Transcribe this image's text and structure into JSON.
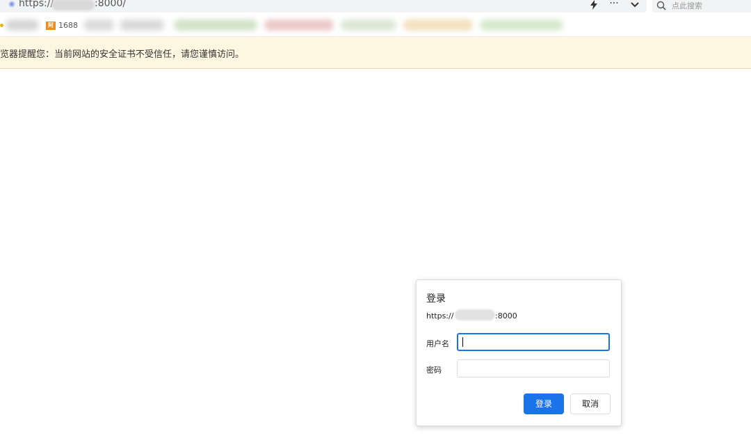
{
  "address_bar": {
    "url_prefix": "https://",
    "url_suffix": ":8000/",
    "lightning_icon": "lightning-icon",
    "more_label": "···",
    "chevron_icon": "chevron-down-icon",
    "search_placeholder": "点此搜索"
  },
  "bookmarks": {
    "items": [
      {
        "label": "1688",
        "icon": "1688-logo-icon",
        "logo_text": "阿里"
      }
    ]
  },
  "warning": {
    "text": "览器提醒您：当前网站的安全证书不受信任，请您谨慎访问。"
  },
  "dialog": {
    "title": "登录",
    "url_prefix": "https://",
    "url_suffix": ":8000",
    "username_label": "用户名",
    "username_value": "",
    "password_label": "密码",
    "password_value": "",
    "login_button": "登录",
    "cancel_button": "取消",
    "accent_color": "#1a73e8"
  },
  "colors": {
    "warning_bg": "#fdf6e0",
    "primary": "#1a73e8"
  }
}
